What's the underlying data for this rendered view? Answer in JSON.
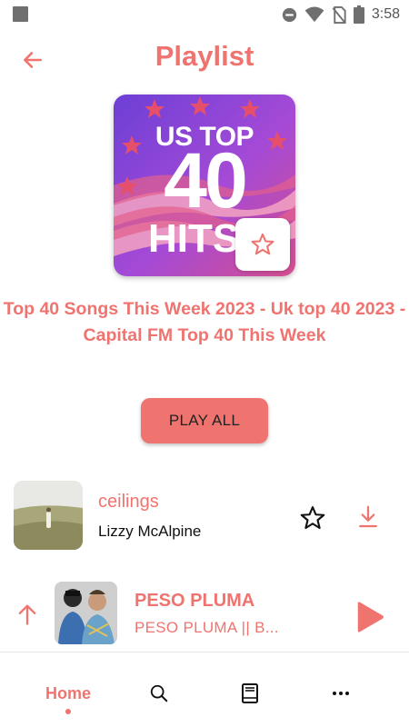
{
  "status_bar": {
    "time": "3:58",
    "icons": [
      "notification-square-icon",
      "do-not-disturb-icon",
      "wifi-icon",
      "no-sim-icon",
      "battery-icon"
    ]
  },
  "header": {
    "title": "Playlist",
    "back_icon": "arrow-left-icon"
  },
  "cover": {
    "line1": "US TOP",
    "line2": "40",
    "line3": "HITS",
    "favorite_icon": "star-outline-icon"
  },
  "playlist": {
    "description": "Top 40 Songs This Week 2023 - Uk top 40 2023 - Capital FM Top 40 This Week",
    "play_all_label": "PLAY ALL"
  },
  "tracks": [
    {
      "title": "ceilings",
      "artist": "Lizzy McAlpine",
      "favorite_icon": "star-outline-icon",
      "download_icon": "download-icon"
    }
  ],
  "now_playing": {
    "title": "PESO PLUMA",
    "subtitle": "PESO PLUMA || B...",
    "expand_icon": "arrow-up-icon",
    "play_icon": "play-icon"
  },
  "bottom_nav": {
    "home_label": "Home",
    "search_icon": "search-icon",
    "library_icon": "book-icon",
    "more_icon": "more-horizontal-icon"
  },
  "colors": {
    "accent": "#ef7470",
    "text_dark": "#111111",
    "background": "#ffffff"
  }
}
